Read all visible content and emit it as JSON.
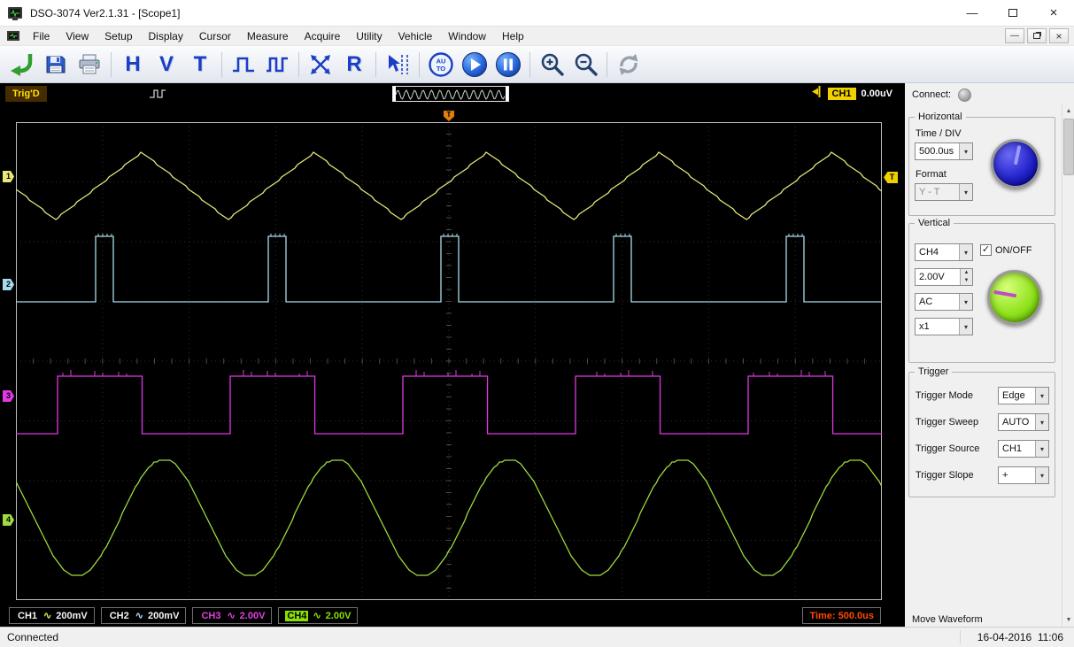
{
  "window": {
    "title": "DSO-3074 Ver2.1.31 - [Scope1]",
    "minimize_glyph": "—",
    "close_glyph": "×"
  },
  "menubar": {
    "items": [
      "File",
      "View",
      "Setup",
      "Display",
      "Cursor",
      "Measure",
      "Acquire",
      "Utility",
      "Vehicle",
      "Window",
      "Help"
    ]
  },
  "toolbar": {
    "buttons": [
      "auto-setup",
      "save",
      "print",
      "horizontal",
      "vertical",
      "trigger",
      "pulse-trigger",
      "pulse-width",
      "math",
      "reference",
      "cursor-measure",
      "auto-scale",
      "run",
      "pause",
      "zoom-in",
      "zoom-out",
      "self-calibration"
    ],
    "h_label": "H",
    "v_label": "V",
    "t_label": "T",
    "r_label": "R",
    "auto_top": "AU",
    "auto_bottom": "TO"
  },
  "trigbar": {
    "status": "Trig'D",
    "channel_badge": "CH1",
    "level": "0.00uV"
  },
  "scope": {
    "channel_markers": [
      "1",
      "2",
      "3",
      "4"
    ],
    "trigger_marker": "T",
    "badges": [
      {
        "name": "CH1",
        "name_color": "#f5f5f5",
        "name_bg": "transparent",
        "symbol": "∿",
        "sym_color": "#e8e85a",
        "value": "200mV",
        "value_color": "#f5f5f5"
      },
      {
        "name": "CH2",
        "name_color": "#f5f5f5",
        "name_bg": "transparent",
        "symbol": "∿",
        "sym_color": "#a8dcec",
        "value": "200mV",
        "value_color": "#f5f5f5"
      },
      {
        "name": "CH3",
        "name_color": "#e040e0",
        "name_bg": "transparent",
        "symbol": "∿",
        "sym_color": "#e040e0",
        "value": "2.00V",
        "value_color": "#e040e0"
      },
      {
        "name": "CH4",
        "name_color": "#000000",
        "name_bg": "#8ae000",
        "symbol": "∿",
        "sym_color": "#8ae000",
        "value": "2.00V",
        "value_color": "#8ae000"
      }
    ],
    "time_badge": "Time: 500.0us",
    "time_color": "#ff4a00"
  },
  "chart_data": {
    "type": "line",
    "title": "4-channel oscilloscope capture",
    "x_axis": {
      "label": "time",
      "divisions": 10,
      "time_per_div": "500.0us"
    },
    "y_axis": {
      "divisions": 8
    },
    "legend_position": "bottom",
    "grid": "dotted",
    "series": [
      {
        "name": "CH1",
        "wave": "triangle",
        "volts_per_div": "200mV",
        "color": "#e8e87a",
        "center": 72,
        "amp": 38,
        "period": 195,
        "peak_x": 142
      },
      {
        "name": "CH2",
        "wave": "pulse",
        "volts_per_div": "200mV",
        "color": "#a8dcec",
        "base": 203,
        "top": 129,
        "period": 195,
        "first_rise": 90,
        "width": 20
      },
      {
        "name": "CH3",
        "wave": "square",
        "volts_per_div": "2.00V",
        "color": "#e238e2",
        "low": 352,
        "high": 287,
        "period": 195,
        "first_rise": 47,
        "duty": 0.49
      },
      {
        "name": "CH4",
        "wave": "sine",
        "volts_per_div": "2.00V",
        "color": "#9fdc3c",
        "center": 447,
        "amp": 66,
        "period": 195,
        "zero_up_x": 118
      }
    ]
  },
  "panel": {
    "connect_label": "Connect:",
    "horizontal": {
      "title": "Horizontal",
      "time_div_label": "Time / DIV",
      "time_div_value": "500.0us",
      "format_label": "Format",
      "format_value": "Y - T"
    },
    "vertical": {
      "title": "Vertical",
      "channel_value": "CH4",
      "onoff_label": "ON/OFF",
      "volts_value": "2.00V",
      "coupling_value": "AC",
      "probe_value": "x1"
    },
    "trigger": {
      "title": "Trigger",
      "rows": [
        {
          "label": "Trigger Mode",
          "value": "Edge"
        },
        {
          "label": "Trigger Sweep",
          "value": "AUTO"
        },
        {
          "label": "Trigger Source",
          "value": "CH1"
        },
        {
          "label": "Trigger Slope",
          "value": "+"
        }
      ]
    },
    "move_waveform_label": "Move Waveform"
  },
  "statusbar": {
    "left": "Connected",
    "right": "16-04-2016  11:06"
  }
}
